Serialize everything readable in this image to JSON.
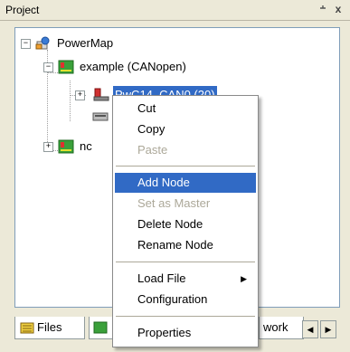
{
  "panel": {
    "title": "Project",
    "pin_icon": "pin-icon",
    "close_label": "x"
  },
  "tree": {
    "root": {
      "label": "PowerMap",
      "expander": "−"
    },
    "child": {
      "label": "example (CANopen)",
      "expander": "−"
    },
    "selected_node": {
      "label": "PwC14_CAN0 (20)",
      "expander": "+"
    },
    "second_node": {
      "label": "nc",
      "expander": "+"
    }
  },
  "tabs": [
    {
      "label": "Files"
    },
    {
      "label": ""
    },
    {
      "label": "work"
    }
  ],
  "context_menu": {
    "items": [
      {
        "label": "Cut",
        "disabled": false
      },
      {
        "label": "Copy",
        "disabled": false
      },
      {
        "label": "Paste",
        "disabled": true
      },
      {
        "label": "Add Node",
        "disabled": false,
        "highlighted": true
      },
      {
        "label": "Set as Master",
        "disabled": true
      },
      {
        "label": "Delete Node",
        "disabled": false
      },
      {
        "label": "Rename Node",
        "disabled": false
      },
      {
        "label": "Load File",
        "disabled": false,
        "submenu": true
      },
      {
        "label": "Configuration",
        "disabled": false
      },
      {
        "label": "Properties",
        "disabled": false
      }
    ]
  },
  "colors": {
    "selection": "#316ac5",
    "disabled": "#aca899",
    "tree_border": "#7f9db9"
  }
}
